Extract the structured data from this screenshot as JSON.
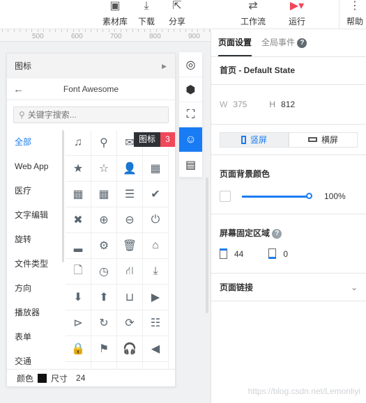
{
  "toolbar": {
    "items": [
      {
        "label": "素材库",
        "icon": "image-icon",
        "glyph": "▣"
      },
      {
        "label": "下载",
        "icon": "download-icon",
        "glyph": "⤓"
      },
      {
        "label": "分享",
        "icon": "share-icon",
        "glyph": "⇱"
      },
      {
        "label": "工作流",
        "icon": "workflow-icon",
        "glyph": "⇄"
      },
      {
        "label": "运行",
        "icon": "play-circle-icon",
        "glyph": "▶▾"
      },
      {
        "label": "帮助",
        "icon": "more-vertical-icon",
        "glyph": "⋮"
      }
    ]
  },
  "ruler": {
    "labels": [
      "500",
      "600",
      "700",
      "800",
      "900"
    ]
  },
  "icon_panel": {
    "header": "图标",
    "library": "Font Awesome",
    "search_placeholder": "关键字搜索...",
    "categories": [
      "全部",
      "Web App",
      "医疗",
      "文字编辑",
      "旋转",
      "文件类型",
      "方向",
      "播放器",
      "表单",
      "交通"
    ],
    "active_category": "全部",
    "icons": [
      [
        "music",
        "♫"
      ],
      [
        "search",
        "⚲"
      ],
      [
        "envelope",
        "✉"
      ],
      [
        "heart",
        "♥"
      ],
      [
        "star",
        "★"
      ],
      [
        "star-o",
        "☆"
      ],
      [
        "user",
        "👤"
      ],
      [
        "film",
        "▦"
      ],
      [
        "th-large",
        "▦"
      ],
      [
        "th",
        "▦"
      ],
      [
        "th-list",
        "☰"
      ],
      [
        "check",
        "✔"
      ],
      [
        "times",
        "✖"
      ],
      [
        "search-plus",
        "⊕"
      ],
      [
        "search-minus",
        "⊖"
      ],
      [
        "power-off",
        "⏻"
      ],
      [
        "signal",
        "▂"
      ],
      [
        "cog",
        "⚙"
      ],
      [
        "trash",
        "🗑"
      ],
      [
        "home",
        "⌂"
      ],
      [
        "file-o",
        "🗋"
      ],
      [
        "clock-o",
        "◷"
      ],
      [
        "road",
        "⛙"
      ],
      [
        "download",
        "⤓"
      ],
      [
        "arrow-circle-down",
        "⬇"
      ],
      [
        "arrow-circle-up",
        "⬆"
      ],
      [
        "inbox",
        "⊔"
      ],
      [
        "play-circle",
        "▶"
      ],
      [
        "play-circle-o",
        "⊳"
      ],
      [
        "repeat",
        "↻"
      ],
      [
        "refresh",
        "⟳"
      ],
      [
        "list-alt",
        "☷"
      ],
      [
        "lock",
        "🔒"
      ],
      [
        "flag",
        "⚑"
      ],
      [
        "headphones",
        "🎧"
      ],
      [
        "volume-off",
        "◀"
      ],
      [
        "volume-down",
        "◀"
      ],
      [
        "volume-up",
        "◀"
      ],
      [
        "qrcode",
        "▦"
      ],
      [
        "barcode",
        "▥"
      ]
    ],
    "footer": {
      "color_label": "颜色",
      "color": "#111111",
      "size_label": "尺寸",
      "size": "24"
    }
  },
  "tooltip": {
    "label": "图标",
    "badge": "3"
  },
  "side_tools": [
    {
      "icon": "target-icon",
      "glyph": "◎"
    },
    {
      "icon": "cube-icon",
      "glyph": "⬢"
    },
    {
      "icon": "scan-icon",
      "glyph": "⛶"
    },
    {
      "icon": "smile-icon",
      "glyph": "☺",
      "active": true
    },
    {
      "icon": "layout-icon",
      "glyph": "▤"
    }
  ],
  "right_panel": {
    "tabs": [
      "页面设置",
      "全局事件"
    ],
    "active_tab": "页面设置",
    "state": "首页 - Default State",
    "width_label": "W",
    "width": "375",
    "height_label": "H",
    "height": "812",
    "orientation": {
      "portrait": "竖屏",
      "landscape": "横屏",
      "active": "portrait"
    },
    "bg_label": "页面背景颜色",
    "opacity": "100",
    "opacity_unit": "%",
    "fixed_label": "屏幕固定区域",
    "fixed_top": "44",
    "fixed_bottom": "0",
    "link_label": "页面链接"
  },
  "accent": "#1a7cf4",
  "watermark": "https://blog.csdn.net/Lemonliyi"
}
